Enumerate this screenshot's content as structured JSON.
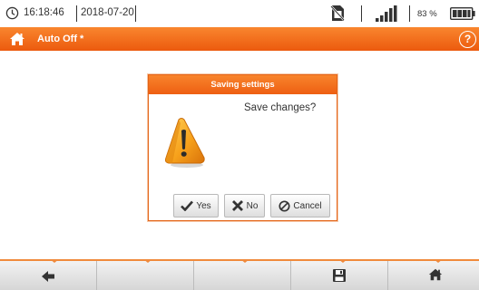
{
  "status_bar": {
    "time": "16:18:46",
    "date": "2018-07-20",
    "battery_percent": "83 %",
    "icons": [
      "clock-icon",
      "no-sim-icon",
      "signal-strength-icon",
      "battery-icon"
    ]
  },
  "title_bar": {
    "title": "Auto Off *",
    "home_icon": "home-icon",
    "help_icon": "help-icon",
    "help_glyph": "?"
  },
  "dialog": {
    "title": "Saving settings",
    "message": "Save changes?",
    "icon": "warning-icon",
    "buttons": {
      "yes": "Yes",
      "no": "No",
      "cancel": "Cancel"
    }
  },
  "bottom_bar": {
    "buttons": [
      "back-arrow-icon",
      "",
      "",
      "save-icon",
      "home-icon"
    ]
  },
  "colors": {
    "accent": "#ef6a1a",
    "accent_light": "#f9862e",
    "text": "#333333",
    "button_bg": "#e8e8e8"
  }
}
